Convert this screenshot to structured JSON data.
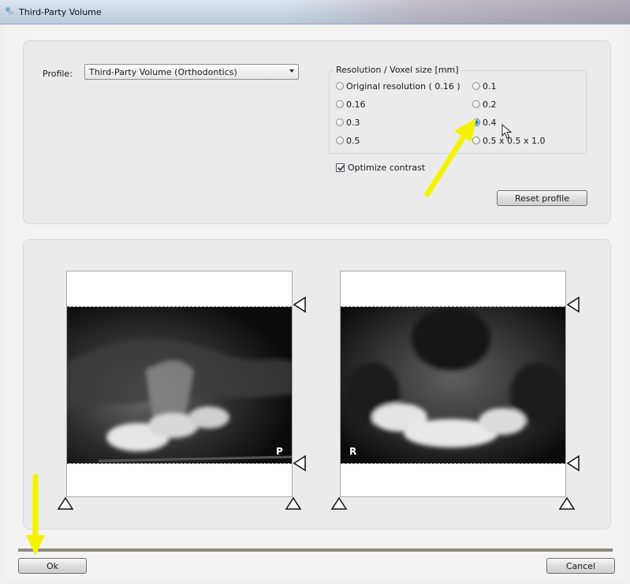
{
  "window": {
    "title": "Third-Party Volume"
  },
  "profile": {
    "label": "Profile:",
    "selected": "Third-Party Volume (Orthodontics)"
  },
  "resolution": {
    "title": "Resolution / Voxel size [mm]",
    "options": [
      {
        "label": "Original resolution ( 0.16 )",
        "checked": false
      },
      {
        "label": "0.1",
        "checked": false
      },
      {
        "label": "0.16",
        "checked": false
      },
      {
        "label": "0.2",
        "checked": false
      },
      {
        "label": "0.3",
        "checked": false
      },
      {
        "label": "0.4",
        "checked": true
      },
      {
        "label": "0.5",
        "checked": false
      },
      {
        "label": "0.5 x 0.5 x 1.0",
        "checked": false
      }
    ]
  },
  "optimize_contrast": {
    "label": "Optimize contrast",
    "checked": true
  },
  "buttons": {
    "reset": "Reset profile",
    "ok": "Ok",
    "cancel": "Cancel"
  },
  "views": [
    {
      "orientation_label": "P"
    },
    {
      "orientation_label": "R"
    }
  ],
  "colors": {
    "annotation_arrow": "#f4f400",
    "radio_selected": "#2a7fc9"
  }
}
